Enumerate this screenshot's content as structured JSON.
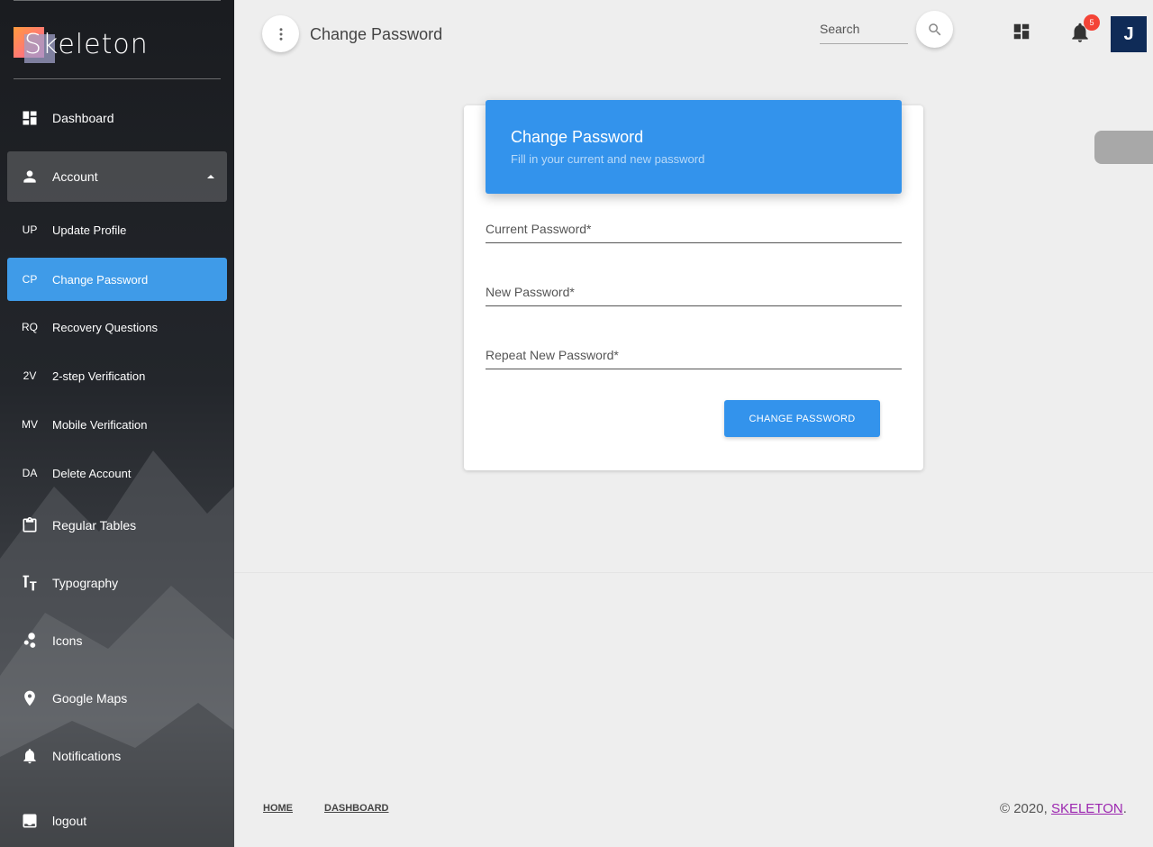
{
  "brand": {
    "name": "Skeleton"
  },
  "sidebar": {
    "dashboard": "Dashboard",
    "account": "Account",
    "sub_items": [
      {
        "abbr": "UP",
        "label": "Update Profile"
      },
      {
        "abbr": "CP",
        "label": "Change Password"
      },
      {
        "abbr": "RQ",
        "label": "Recovery Questions"
      },
      {
        "abbr": "2V",
        "label": "2-step Verification"
      },
      {
        "abbr": "MV",
        "label": "Mobile Verification"
      },
      {
        "abbr": "DA",
        "label": "Delete Account"
      }
    ],
    "items": [
      {
        "label": "Regular Tables",
        "icon": "clipboard-icon"
      },
      {
        "label": "Typography",
        "icon": "typography-icon"
      },
      {
        "label": "Icons",
        "icon": "bubbles-icon"
      },
      {
        "label": "Google Maps",
        "icon": "map-pin-icon"
      },
      {
        "label": "Notifications",
        "icon": "bell-icon"
      },
      {
        "label": "logout",
        "icon": "logout-icon"
      }
    ]
  },
  "header": {
    "title": "Change Password",
    "search_placeholder": "Search",
    "notification_count": "5",
    "avatar_initial": "J"
  },
  "card": {
    "title": "Change Password",
    "subtitle": "Fill in your current and new password",
    "fields": {
      "current": "Current Password*",
      "new": "New Password*",
      "repeat": "Repeat New Password*"
    },
    "submit": "CHANGE PASSWORD"
  },
  "footer": {
    "home": "HOME",
    "dashboard": "DASHBOARD",
    "copyright_prefix": "© 2020, ",
    "copyright_link": "SKELETON",
    "copyright_suffix": "."
  },
  "colors": {
    "primary": "#3393ec",
    "badge": "#f44336",
    "avatar": "#0f2b57",
    "link": "#9c27b0"
  }
}
